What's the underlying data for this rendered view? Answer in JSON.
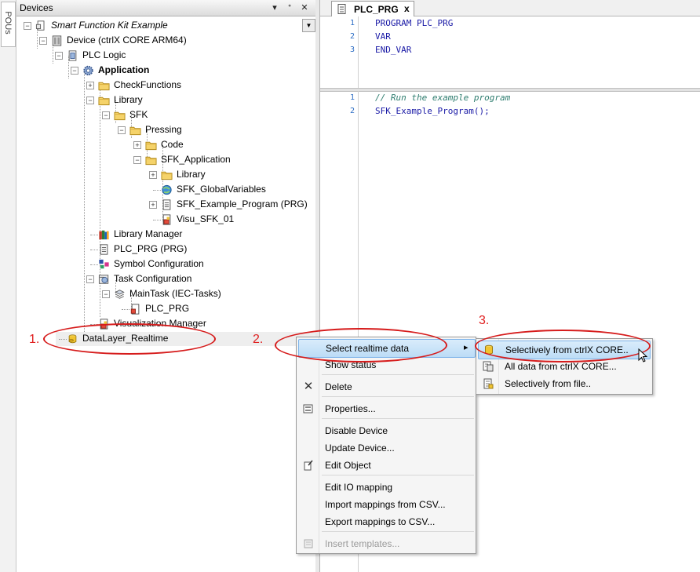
{
  "left_strip": {
    "tab_label": "POUs"
  },
  "devices_panel": {
    "title": "Devices",
    "header_buttons": {
      "dropdown": "▾",
      "pin": "ᐩ",
      "close": "✕"
    },
    "tree": [
      {
        "label": "Smart Function Kit Example",
        "italic": true
      },
      {
        "label": "Device (ctrlX CORE ARM64)"
      },
      {
        "label": "PLC Logic"
      },
      {
        "label": "Application",
        "bold": true
      },
      {
        "label": "CheckFunctions"
      },
      {
        "label": "Library"
      },
      {
        "label": "SFK"
      },
      {
        "label": "Pressing"
      },
      {
        "label": "Code"
      },
      {
        "label": "SFK_Application"
      },
      {
        "label": "Library"
      },
      {
        "label": "SFK_GlobalVariables"
      },
      {
        "label": "SFK_Example_Program (PRG)"
      },
      {
        "label": "Visu_SFK_01"
      },
      {
        "label": "Library Manager"
      },
      {
        "label": "PLC_PRG (PRG)"
      },
      {
        "label": "Symbol Configuration"
      },
      {
        "label": "Task Configuration"
      },
      {
        "label": "MainTask (IEC-Tasks)"
      },
      {
        "label": "PLC_PRG"
      },
      {
        "label": "Visualization Manager"
      },
      {
        "label": "DataLayer_Realtime"
      }
    ]
  },
  "editor": {
    "tab_label": "PLC_PRG",
    "tab_close": "x",
    "declaration_lines": [
      {
        "n": "1",
        "code": "PROGRAM PLC_PRG"
      },
      {
        "n": "2",
        "code": "VAR"
      },
      {
        "n": "3",
        "code": "END_VAR"
      }
    ],
    "body_lines": [
      {
        "n": "1",
        "code": "// Run the example program",
        "comment": true
      },
      {
        "n": "2",
        "code": "SFK_Example_Program();"
      }
    ]
  },
  "context_menu": {
    "items": [
      {
        "label": "Select realtime data",
        "highlight": true,
        "submenu": true
      },
      {
        "label": "Show status"
      },
      {
        "label": "Delete",
        "icon": "close-icon"
      },
      {
        "label": "Properties...",
        "icon": "properties-icon"
      },
      {
        "label": "Disable Device"
      },
      {
        "label": "Update Device..."
      },
      {
        "label": "Edit Object",
        "icon": "edit-object-icon"
      },
      {
        "label": "Edit IO mapping"
      },
      {
        "label": "Import mappings from CSV..."
      },
      {
        "label": "Export mappings to CSV..."
      },
      {
        "label": "Insert templates...",
        "disabled": true,
        "icon": "insert-templates-icon"
      }
    ],
    "submenu_arrow": "▸"
  },
  "sub_menu": {
    "items": [
      {
        "label": "Selectively from ctrlX CORE..",
        "highlight": true,
        "icon": "database-icon"
      },
      {
        "label": "All data from ctrlX CORE...",
        "icon": "all-data-icon"
      },
      {
        "label": "Selectively from file..",
        "icon": "file-icon"
      }
    ]
  },
  "annotations": [
    "1.",
    "2.",
    "3."
  ],
  "colors": {
    "annotation": "#e02020",
    "keyword": "#1a1aa6",
    "comment": "#2e7d6f",
    "line_number": "#2b6cc4",
    "highlight": "#bcdcf6"
  }
}
